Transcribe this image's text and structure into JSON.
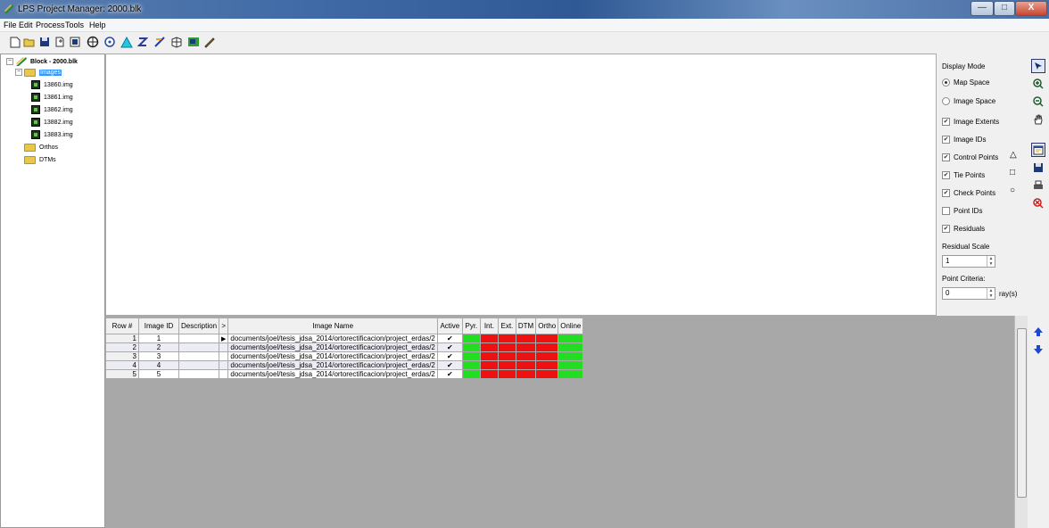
{
  "window": {
    "title": "LPS Project Manager: 2000.blk",
    "minimize": "—",
    "maximize": "□",
    "close": "X"
  },
  "menu": [
    "File",
    "Edit",
    "Process",
    "Tools",
    "Help"
  ],
  "toolbar_icons": [
    "new-icon",
    "open-icon",
    "save-icon",
    "add-image-icon",
    "properties-icon",
    "frame-editor-icon",
    "point-measurement-icon",
    "triangulation-icon",
    "dtm-extract-icon",
    "ortho-icon",
    "mosaic-icon",
    "image-info-icon",
    "edit-tool-icon"
  ],
  "tree": {
    "root": "Block - 2000.blk",
    "images_folder": "Images",
    "images": [
      "13860.img",
      "13861.img",
      "13862.img",
      "13882.img",
      "13883.img"
    ],
    "orthos": "Orthos",
    "dtms": "DTMs"
  },
  "display": {
    "title": "Display Mode",
    "map_space": "Map Space",
    "image_space": "Image Space",
    "mode_selected": "Map Space",
    "checks": [
      {
        "label": "Image Extents",
        "checked": true
      },
      {
        "label": "Image IDs",
        "checked": true
      },
      {
        "label": "Control Points",
        "checked": true,
        "symbol": "△"
      },
      {
        "label": "Tie Points",
        "checked": true,
        "symbol": "□"
      },
      {
        "label": "Check Points",
        "checked": true,
        "symbol": "○"
      },
      {
        "label": "Point IDs",
        "checked": false
      },
      {
        "label": "Residuals",
        "checked": true
      }
    ],
    "residual_scale_label": "Residual Scale",
    "residual_scale_value": "1",
    "point_criteria_label": "Point Criteria:",
    "point_criteria_value": "0",
    "point_criteria_unit": "ray(s)"
  },
  "table": {
    "headers": [
      "Row #",
      "Image ID",
      "Description",
      ">",
      "Image Name",
      "Active",
      "Pyr.",
      "Int.",
      "Ext.",
      "DTM",
      "Ortho",
      "Online"
    ],
    "rows": [
      {
        "row": "1",
        "id": "1",
        "desc": "",
        "name": "documents/joel/tesis_jdsa_2014/ortorectificacion/project_erdas/2",
        "active": "✔",
        "status": [
          "ok",
          "bad",
          "bad",
          "bad",
          "bad",
          "ok"
        ]
      },
      {
        "row": "2",
        "id": "2",
        "desc": "",
        "name": "documents/joel/tesis_jdsa_2014/ortorectificacion/project_erdas/2",
        "active": "✔",
        "status": [
          "ok",
          "bad",
          "bad",
          "bad",
          "bad",
          "ok"
        ]
      },
      {
        "row": "3",
        "id": "3",
        "desc": "",
        "name": "documents/joel/tesis_jdsa_2014/ortorectificacion/project_erdas/2",
        "active": "✔",
        "status": [
          "ok",
          "bad",
          "bad",
          "bad",
          "bad",
          "ok"
        ]
      },
      {
        "row": "4",
        "id": "4",
        "desc": "",
        "name": "documents/joel/tesis_jdsa_2014/ortorectificacion/project_erdas/2",
        "active": "✔",
        "status": [
          "ok",
          "bad",
          "bad",
          "bad",
          "bad",
          "ok"
        ]
      },
      {
        "row": "5",
        "id": "5",
        "desc": "",
        "name": "documents/joel/tesis_jdsa_2014/ortorectificacion/project_erdas/2",
        "active": "✔",
        "status": [
          "ok",
          "bad",
          "bad",
          "bad",
          "bad",
          "ok"
        ]
      }
    ]
  }
}
